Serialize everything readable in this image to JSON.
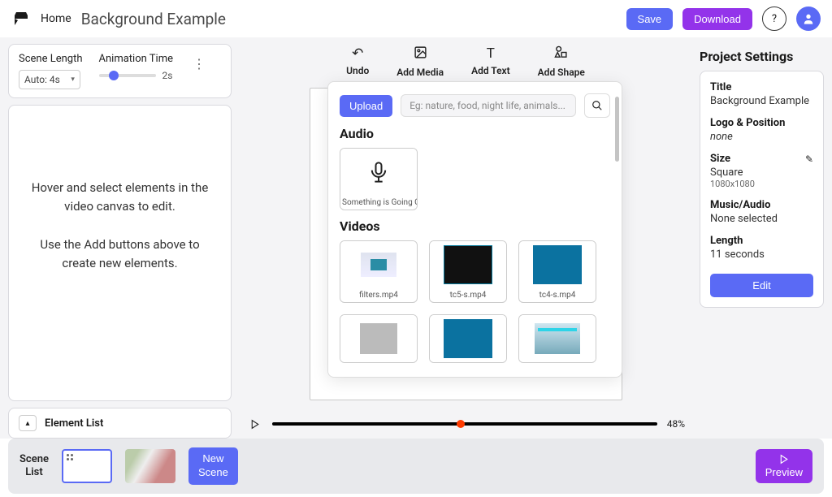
{
  "topbar": {
    "home": "Home",
    "title": "Background Example",
    "save": "Save",
    "download": "Download"
  },
  "scene_settings": {
    "length_label": "Scene Length",
    "length_value": "Auto: 4s",
    "anim_label": "Animation Time",
    "anim_value": "2s"
  },
  "canvas_hint": {
    "l1": "Hover and select elements in the video canvas to edit.",
    "l2": "Use the Add buttons above to create new elements."
  },
  "element_list": {
    "label": "Element List"
  },
  "toolbar": {
    "undo": "Undo",
    "add_media": "Add Media",
    "add_text": "Add Text",
    "add_shape": "Add Shape"
  },
  "media_panel": {
    "upload": "Upload",
    "search_placeholder": "Eg: nature, food, night life, animals...",
    "audio_header": "Audio",
    "videos_header": "Videos",
    "audio_items": [
      {
        "label": "Something is Going On"
      }
    ],
    "video_items": [
      {
        "label": "filters.mp4"
      },
      {
        "label": "tc5-s.mp4"
      },
      {
        "label": "tc4-s.mp4"
      }
    ]
  },
  "timeline": {
    "pct": "48%",
    "progress": 0.48
  },
  "project": {
    "header": "Project Settings",
    "title_label": "Title",
    "title_value": "Background Example",
    "logo_label": "Logo & Position",
    "logo_value": "none",
    "size_label": "Size",
    "size_value": "Square",
    "size_dims": "1080x1080",
    "music_label": "Music/Audio",
    "music_value": "None selected",
    "length_label": "Length",
    "length_value": "11 seconds",
    "edit": "Edit"
  },
  "bottom": {
    "scene_list": "Scene\nList",
    "new_scene": "New\nScene",
    "preview": "Preview"
  }
}
